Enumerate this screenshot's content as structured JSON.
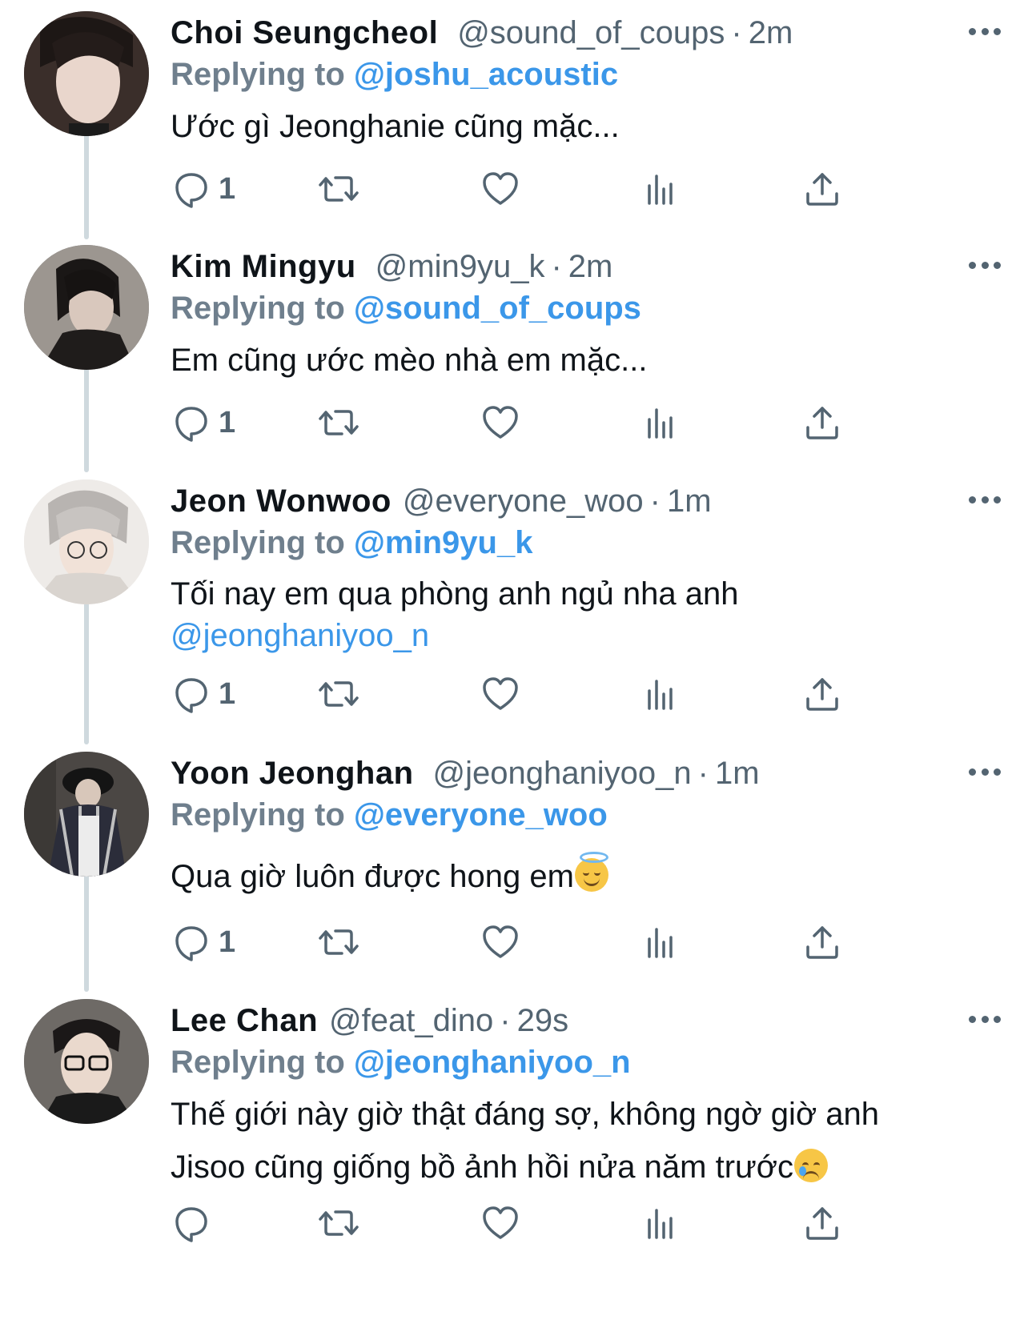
{
  "colors": {
    "link": "#3b97e9",
    "secondary_text": "#536471",
    "thread_line": "#cfd9de"
  },
  "icons": {
    "more": "more-horizontal-icon",
    "reply": "reply-icon",
    "retweet": "retweet-icon",
    "like": "heart-icon",
    "views": "analytics-icon",
    "share": "share-icon"
  },
  "tweets": [
    {
      "name": "Choi Seungcheol",
      "handle": "@sound_of_coups",
      "dot": "·",
      "time": "2m",
      "replying_label": "Replying to",
      "replying_to": "@joshu_acoustic",
      "text_line1": "Ước gì Jeonghanie cũng mặc...",
      "reply_count": "1"
    },
    {
      "name": "Kim Mingyu",
      "handle": "@min9yu_k",
      "dot": "·",
      "time": "2m",
      "replying_label": "Replying to",
      "replying_to": "@sound_of_coups",
      "text_line1": "Em cũng ước mèo nhà em mặc...",
      "reply_count": "1"
    },
    {
      "name": "Jeon Wonwoo",
      "handle": "@everyone_woo",
      "dot": "·",
      "time": "1m",
      "replying_label": "Replying to",
      "replying_to": "@min9yu_k",
      "text_line1": "Tối nay em qua phòng anh ngủ nha anh",
      "text_mention": "@jeonghaniyoo_n",
      "reply_count": "1"
    },
    {
      "name": "Yoon Jeonghan",
      "handle": "@jeonghaniyoo_n",
      "dot": "·",
      "time": "1m",
      "replying_label": "Replying to",
      "replying_to": "@everyone_woo",
      "text_line1": "Qua giờ luôn được hong em",
      "emoji": "smiling-face-with-halo",
      "reply_count": "1"
    },
    {
      "name": "Lee Chan",
      "handle": "@feat_dino",
      "dot": "·",
      "time": "29s",
      "replying_label": "Replying to",
      "replying_to": "@jeonghaniyoo_n",
      "text_line1": "Thế giới này giờ thật đáng sợ, không ngờ giờ anh",
      "text_line2": "Jisoo cũng giống bồ ảnh hồi nửa năm trước",
      "emoji": "crying-face",
      "reply_count": ""
    }
  ]
}
